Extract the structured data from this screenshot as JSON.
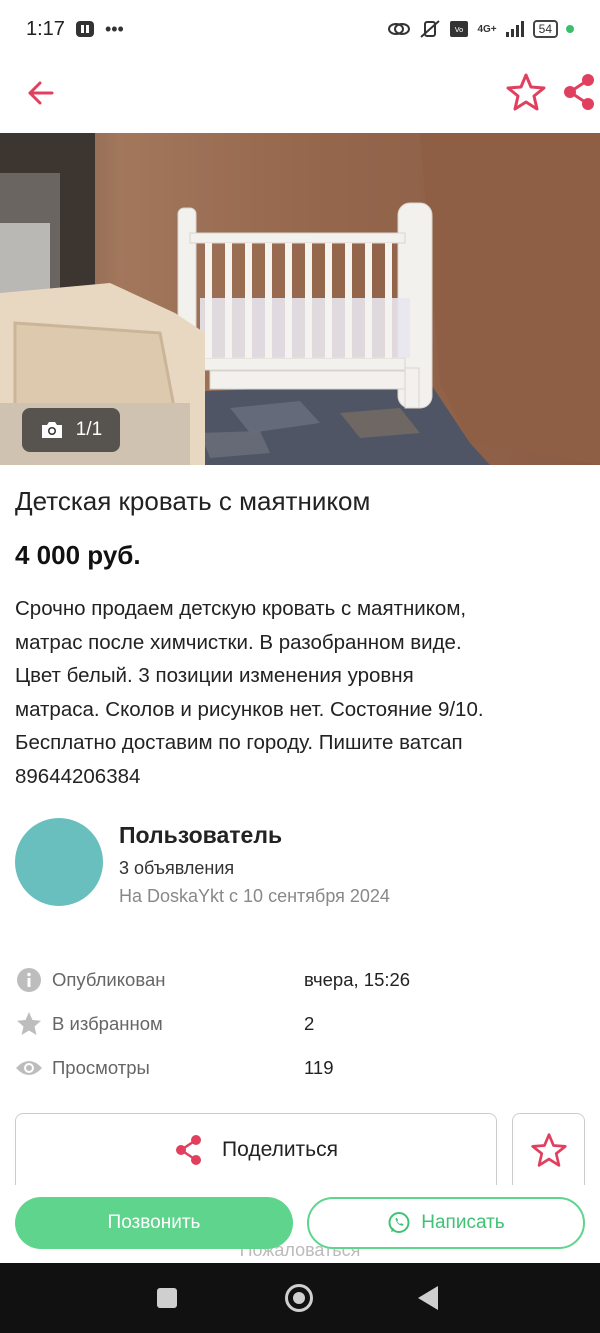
{
  "status_bar": {
    "time": "1:17",
    "battery": "54",
    "network": "4G+"
  },
  "listing": {
    "title": "Детская кровать с маятником",
    "price": "4 000 руб.",
    "description": "Срочно продаем детскую кровать с маятником,\nматрас после химчистки. В разобранном виде.\nЦвет белый. 3 позиции изменения уровня\nматраса. Сколов и рисунков нет. Состояние 9/10.\nБесплатно доставим по городу. Пишите ватсап\n89644206384",
    "photo_counter": "1/1"
  },
  "seller": {
    "name": "Пользователь",
    "ads_count": "3 объявления",
    "member_since": "На DoskaYkt с 10 сентября 2024"
  },
  "stats": [
    {
      "icon": "info-icon",
      "label": "Опубликован",
      "value": "вчера, 15:26"
    },
    {
      "icon": "star-icon",
      "label": "В избранном",
      "value": "2"
    },
    {
      "icon": "eye-icon",
      "label": "Просмотры",
      "value": "119"
    }
  ],
  "actions": {
    "share_label": "Поделиться",
    "call_label": "Позвонить",
    "write_label": "Написать",
    "report_label": "Пожаловаться"
  },
  "colors": {
    "accent": "#e0405e",
    "green": "#5fd48d",
    "avatar": "#69bfbe"
  }
}
